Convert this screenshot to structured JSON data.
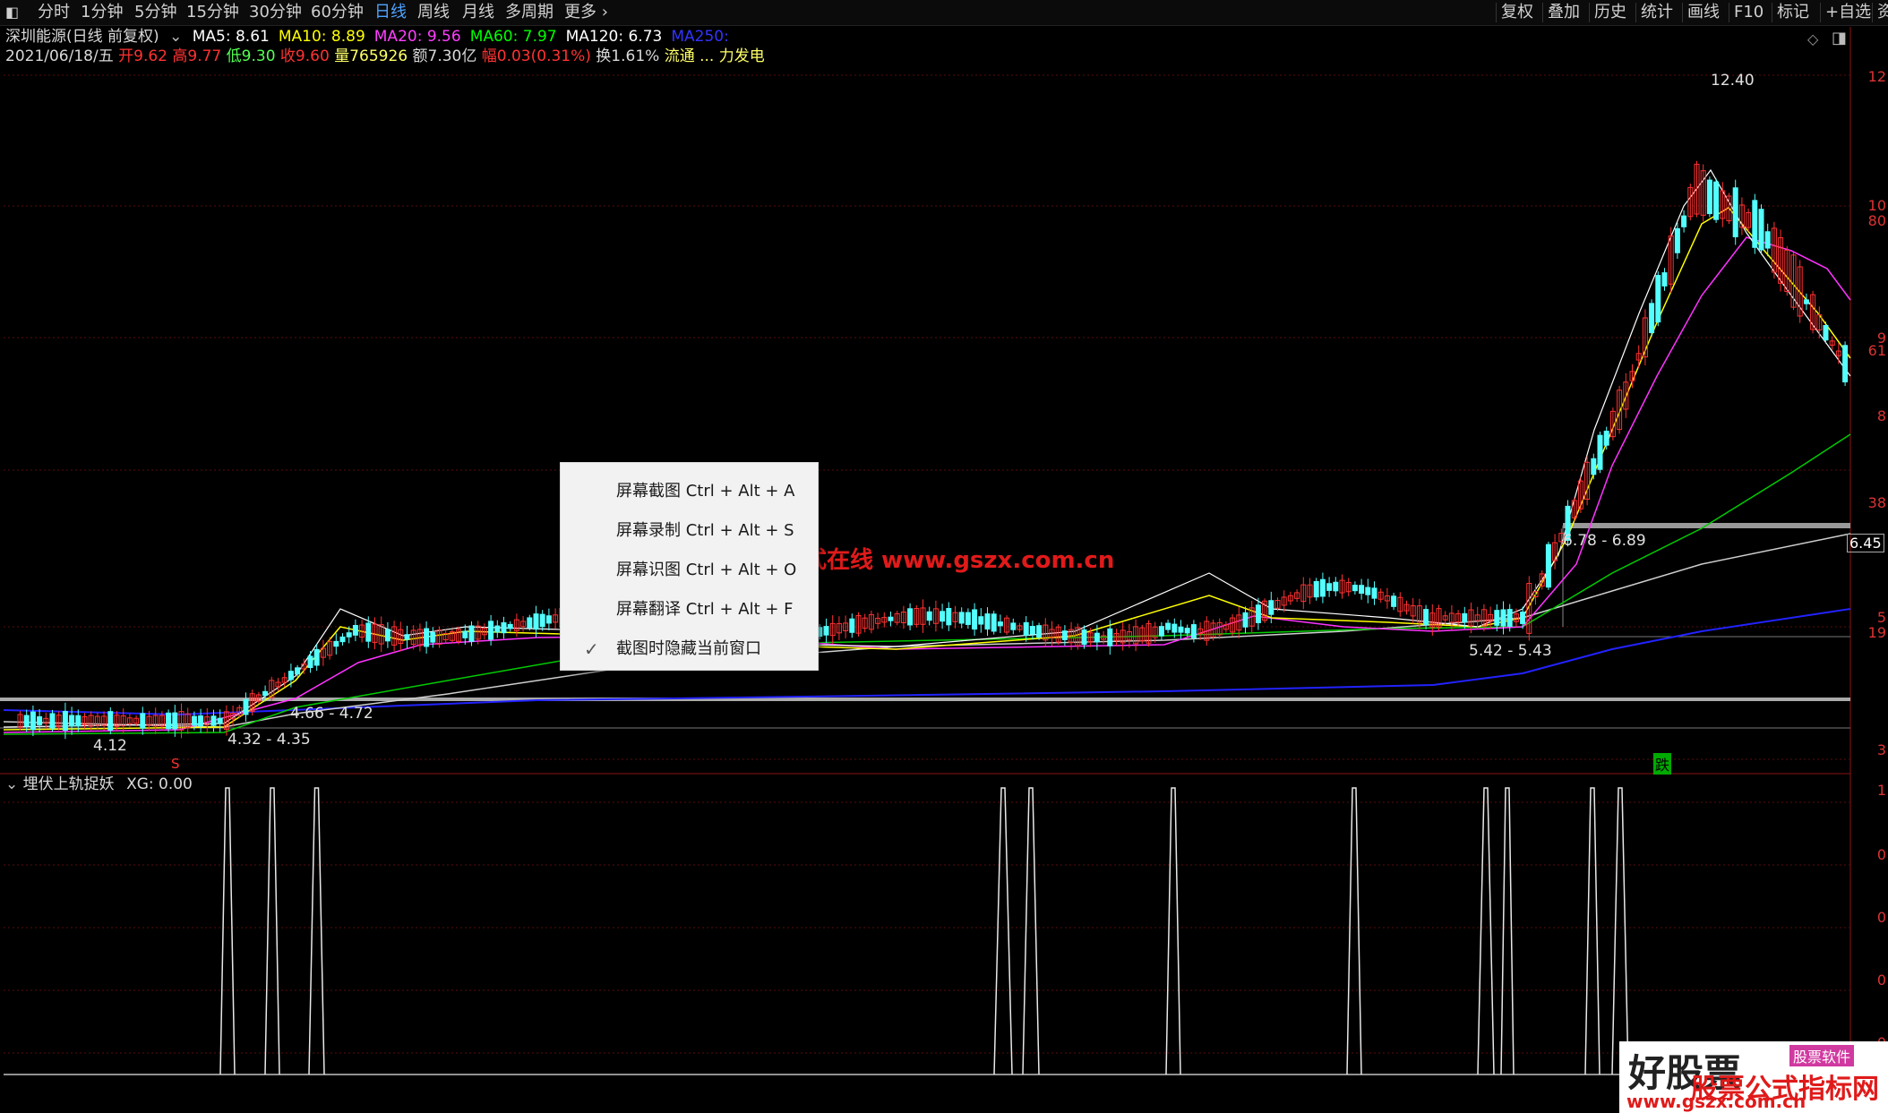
{
  "toolbar": {
    "window_icon": "window-icon",
    "periods": [
      "分时",
      "1分钟",
      "5分钟",
      "15分钟",
      "30分钟",
      "60分钟",
      "日线",
      "周线",
      "月线",
      "多周期",
      "更多"
    ],
    "active_period": "日线",
    "more_chevron": "chevron-right-icon",
    "right_items": [
      "复权",
      "叠加",
      "历史",
      "统计",
      "画线",
      "F10",
      "标记",
      "+自选",
      "资"
    ]
  },
  "stock": {
    "name": "深圳能源(日线 前复权)",
    "ma_labels": [
      "MA5: 8.61",
      "MA10: 8.89",
      "MA20: 9.56",
      "MA60: 7.97",
      "MA120: 6.73",
      "MA250:"
    ],
    "ma_colors": [
      "#ffffff",
      "#ffff00",
      "#ff40ff",
      "#00ff00",
      "#ffffff",
      "#3333ff"
    ],
    "date": "2021/06/18/五",
    "open": "开9.62",
    "high": "高9.77",
    "low": "低9.30",
    "close": "收9.60",
    "volume": "量765926",
    "amount": "额7.30亿",
    "change": "幅0.03(0.31%)",
    "turnover": "换1.61%",
    "extra": "流通 ... 力发电"
  },
  "price_axis": [
    "12",
    "10",
    "80",
    "9",
    "61",
    "8",
    "38",
    "6.45",
    "5",
    "19",
    "3"
  ],
  "price_annotations": {
    "high": "12.40",
    "range1": "6.78 - 6.89",
    "range2": "5.42 - 5.43",
    "range3": "4.66 - 4.72",
    "range4": "4.32 - 4.35",
    "low": "4.12"
  },
  "markers": {
    "buy": "S",
    "sell": "跌"
  },
  "indicator": {
    "name": "埋伏上轨捉妖",
    "value_label": "XG: 0.00",
    "axis": [
      "1",
      "0",
      "0",
      "0",
      "0"
    ]
  },
  "context_menu": {
    "items": [
      {
        "label": "屏幕截图 Ctrl + Alt + A",
        "checked": false
      },
      {
        "label": "屏幕录制 Ctrl + Alt + S",
        "checked": false
      },
      {
        "label": "屏幕识图 Ctrl + Alt + O",
        "checked": false
      },
      {
        "label": "屏幕翻译 Ctrl + Alt + F",
        "checked": false
      },
      {
        "label": "截图时隐藏当前窗口",
        "checked": true
      }
    ]
  },
  "watermark": {
    "text": "公式在线  www.gszx.com.cn"
  },
  "brand": {
    "big": "好股票",
    "tag": "股票软件",
    "line1": "股票公式指标网",
    "url": "www.gszx.com.cn"
  },
  "colors": {
    "up": "#ff3232",
    "down": "#54ffff",
    "axis": "#d33333",
    "active_tab": "#4fa3ff"
  }
}
